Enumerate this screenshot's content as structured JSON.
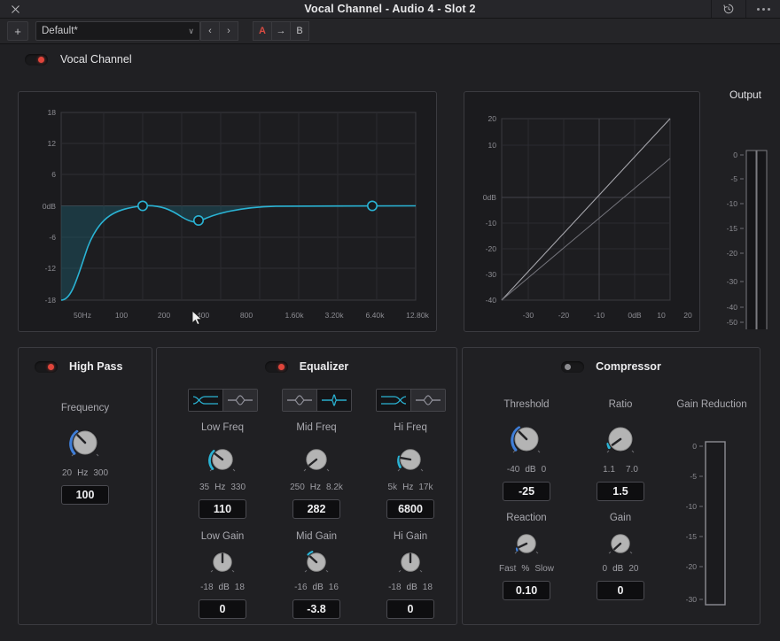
{
  "window": {
    "title": "Vocal Channel - Audio 4 -  Slot 2",
    "close_icon": "close-icon",
    "reset_icon": "reset-history-icon",
    "more_icon": "more-options-icon"
  },
  "presetbar": {
    "add_label": "+",
    "preset_value": "Default*",
    "chevron": "∨",
    "prev_label": "‹",
    "next_label": "›",
    "a_label": "A",
    "copy_label": "→",
    "b_label": "B"
  },
  "master": {
    "name": "Vocal Channel",
    "enabled": true
  },
  "eq_graph": {
    "y_ticks": [
      "18",
      "12",
      "6",
      "0dB",
      "-6",
      "-12",
      "-18"
    ],
    "x_ticks": [
      "50Hz",
      "100",
      "200",
      "400",
      "800",
      "1.60k",
      "3.20k",
      "6.40k",
      "12.80k"
    ],
    "accent": "#2ab3d4",
    "handles": [
      {
        "name": "low-band-handle",
        "filled": true
      },
      {
        "name": "mid-band-handle",
        "filled": false
      },
      {
        "name": "high-band-handle",
        "filled": false
      }
    ]
  },
  "comp_graph": {
    "y_ticks": [
      "20",
      "10",
      "0dB",
      "-10",
      "-20",
      "-30",
      "-40"
    ],
    "x_ticks": [
      "-30",
      "-20",
      "-10",
      "0dB",
      "10",
      "20"
    ]
  },
  "output": {
    "title": "Output",
    "ticks": [
      "0",
      "-5",
      "-10",
      "-15",
      "-20",
      "-30",
      "-40",
      "-50"
    ]
  },
  "highpass": {
    "title": "High Pass",
    "enabled": true,
    "frequency": {
      "label": "Frequency",
      "min": "20",
      "unit": "Hz",
      "max": "300",
      "value": "100"
    }
  },
  "equalizer": {
    "title": "Equalizer",
    "enabled": true,
    "bands": [
      {
        "freq_label": "Low Freq",
        "freq_min": "35",
        "freq_unit": "Hz",
        "freq_max": "330",
        "freq_value": "110",
        "gain_label": "Low Gain",
        "gain_min": "-18",
        "gain_unit": "dB",
        "gain_max": "18",
        "gain_value": "0",
        "filter_types": [
          "low-shelf-icon",
          "bell-icon"
        ],
        "selected_filter": 0
      },
      {
        "freq_label": "Mid Freq",
        "freq_min": "250",
        "freq_unit": "Hz",
        "freq_max": "8.2k",
        "freq_value": "282",
        "gain_label": "Mid Gain",
        "gain_min": "-16",
        "gain_unit": "dB",
        "gain_max": "16",
        "gain_value": "-3.8",
        "filter_types": [
          "wide-bell-icon",
          "narrow-bell-icon"
        ],
        "selected_filter": 1
      },
      {
        "freq_label": "Hi Freq",
        "freq_min": "5k",
        "freq_unit": "Hz",
        "freq_max": "17k",
        "freq_value": "6800",
        "gain_label": "Hi Gain",
        "gain_min": "-18",
        "gain_unit": "dB",
        "gain_max": "18",
        "gain_value": "0",
        "filter_types": [
          "high-shelf-icon",
          "bell-icon"
        ],
        "selected_filter": 0
      }
    ]
  },
  "compressor": {
    "title": "Compressor",
    "enabled": false,
    "threshold": {
      "label": "Threshold",
      "min": "-40",
      "unit": "dB",
      "max": "0",
      "value": "-25"
    },
    "ratio": {
      "label": "Ratio",
      "min": "1.1",
      "unit": "",
      "max": "7.0",
      "value": "1.5"
    },
    "reaction": {
      "label": "Reaction",
      "min": "Fast",
      "unit": "%",
      "max": "Slow",
      "value": "0.10"
    },
    "gain": {
      "label": "Gain",
      "min": "0",
      "unit": "dB",
      "max": "20",
      "value": "0"
    },
    "gain_reduction": {
      "label": "Gain Reduction",
      "ticks": [
        "0",
        "-5",
        "-10",
        "-15",
        "-20",
        "-30"
      ]
    }
  }
}
